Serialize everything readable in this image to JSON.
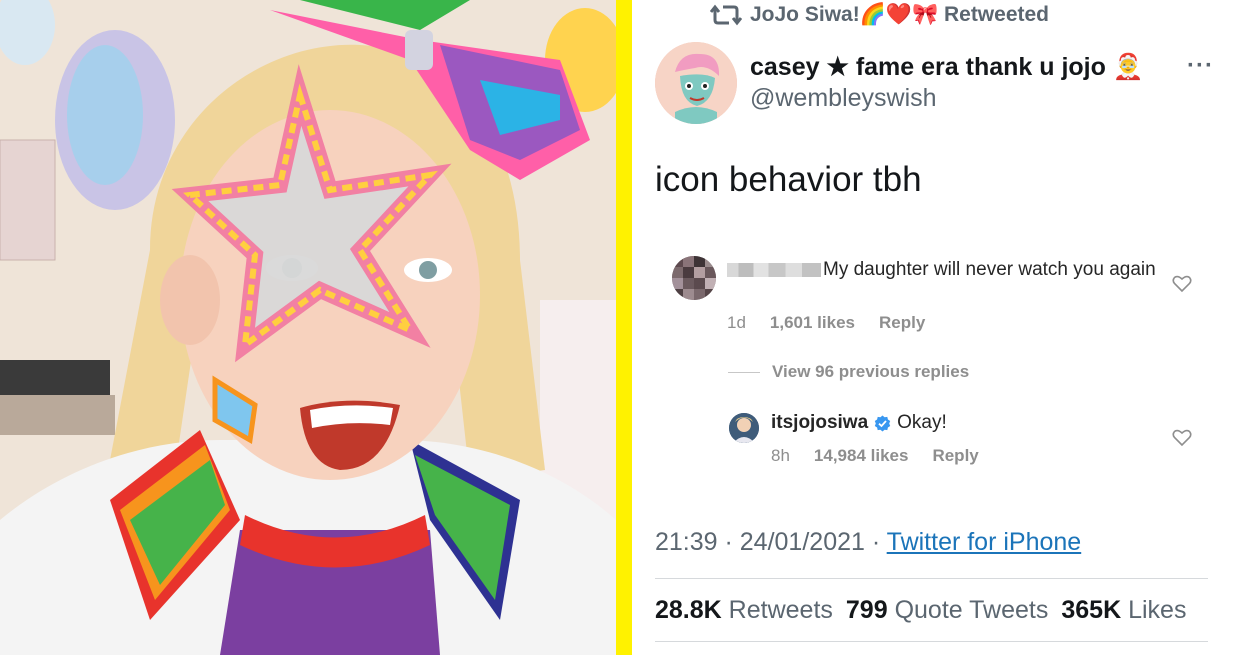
{
  "photo": {
    "alt_subject": ""
  },
  "retweet_bar": {
    "icon": "retweet-icon",
    "label": "JoJo Siwa!🌈❤️🎀 Retweeted"
  },
  "tweet": {
    "display_name": "casey ★ fame era thank u jojo 🤶",
    "handle": "@wembleyswish",
    "more_label": "···",
    "text": "icon behavior tbh",
    "timestamp": "21:39 · 24/01/2021 · ",
    "source": "Twitter for iPhone",
    "stats": {
      "retweets_count": "28.8K",
      "retweets_label": "Retweets",
      "quotes_count": "799",
      "quotes_label": "Quote Tweets",
      "likes_count": "365K",
      "likes_label": "Likes"
    }
  },
  "comments": {
    "first": {
      "text": "My daughter will never watch you again",
      "age": "1d",
      "likes": "1,601 likes",
      "reply": "Reply"
    },
    "view_replies": "View 96 previous replies",
    "reply": {
      "username": "itsjojosiwa",
      "text": "Okay!",
      "age": "8h",
      "likes": "14,984 likes",
      "reply": "Reply"
    }
  },
  "colors": {
    "divider": "#fff200",
    "link": "#1b74b9",
    "verified": "#3897f0",
    "muted": "#5b6670"
  }
}
